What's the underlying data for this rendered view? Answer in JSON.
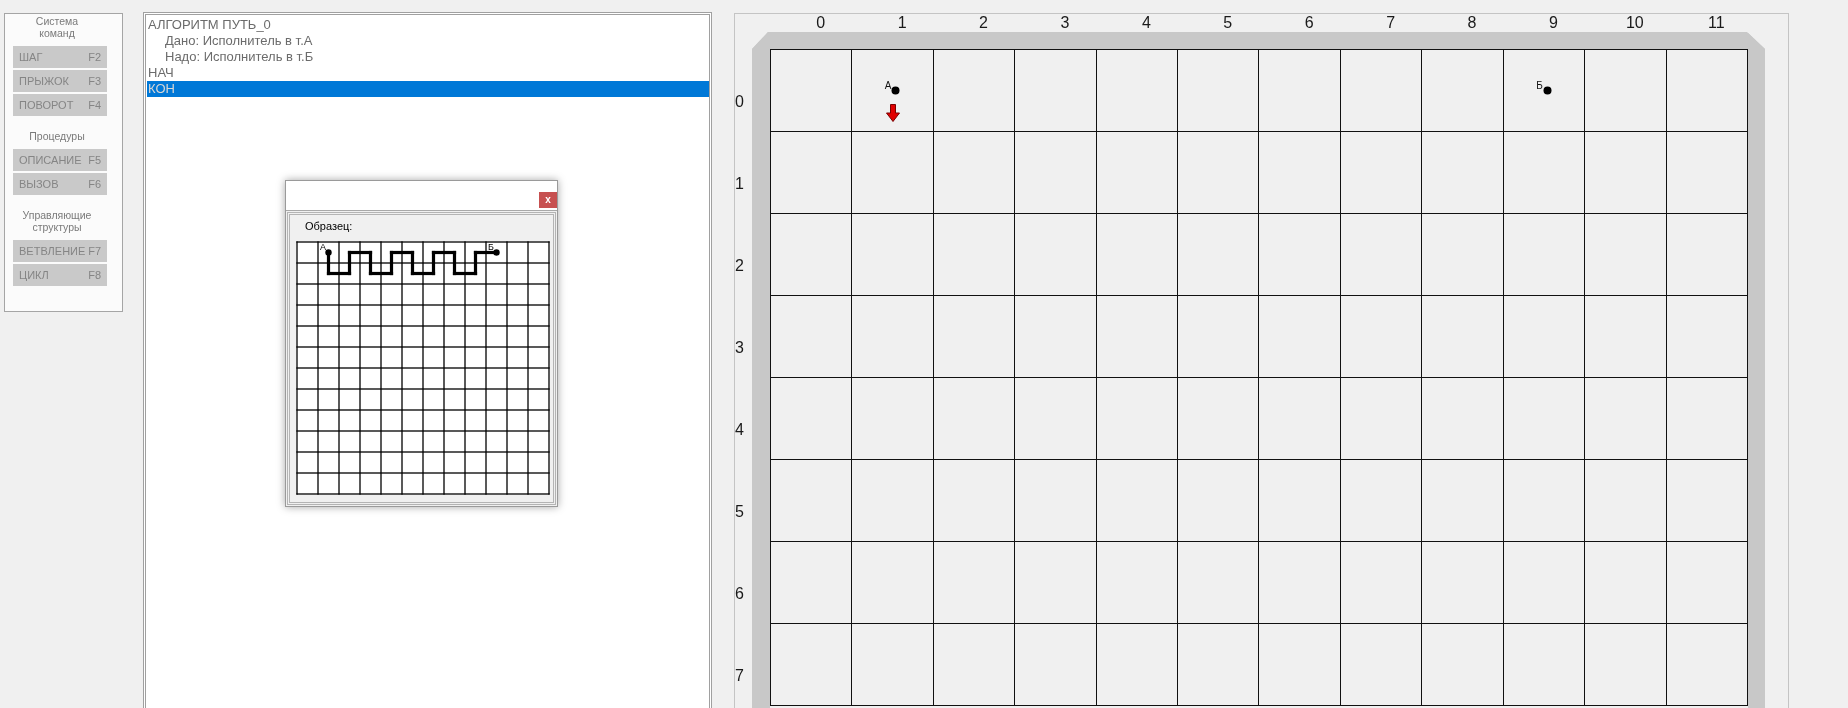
{
  "command_panel": {
    "groups": [
      {
        "title": "Система команд",
        "commands": [
          {
            "label": "ШАГ",
            "key": "F2",
            "disabled": true
          },
          {
            "label": "ПРЫЖОК",
            "key": "F3",
            "disabled": true
          },
          {
            "label": "ПОВОРОТ",
            "key": "F4",
            "disabled": true
          }
        ]
      },
      {
        "title": "Процедуры",
        "commands": [
          {
            "label": "ОПИСАНИЕ",
            "key": "F5",
            "disabled": true
          },
          {
            "label": "ВЫЗОВ",
            "key": "F6",
            "disabled": true
          }
        ]
      },
      {
        "title": "Управляющие структуры",
        "commands": [
          {
            "label": "ВЕТВЛЕНИЕ",
            "key": "F7",
            "disabled": true
          },
          {
            "label": "ЦИКЛ",
            "key": "F8",
            "disabled": true
          }
        ]
      }
    ]
  },
  "editor": {
    "lines": [
      {
        "text": "АЛГОРИТМ ПУТЬ_0",
        "selected": false,
        "children": [
          {
            "text": "Дано: Исполнитель в т.А",
            "selected": false
          },
          {
            "text": "Надо: Исполнитель в т.Б",
            "selected": false
          }
        ]
      },
      {
        "text": "НАЧ",
        "selected": false
      },
      {
        "text": "КОН",
        "selected": true
      }
    ]
  },
  "sample_window": {
    "close_label": "x",
    "label": "Образец:",
    "points": [
      {
        "label": "А"
      },
      {
        "label": "Б"
      }
    ]
  },
  "field": {
    "columns": [
      "0",
      "1",
      "2",
      "3",
      "4",
      "5",
      "6",
      "7",
      "8",
      "9",
      "10",
      "11"
    ],
    "rows": [
      "0",
      "1",
      "2",
      "3",
      "4",
      "5",
      "6",
      "7"
    ],
    "points": [
      {
        "label": "А"
      },
      {
        "label": "Б"
      }
    ],
    "robot": {
      "kind": "down"
    }
  }
}
